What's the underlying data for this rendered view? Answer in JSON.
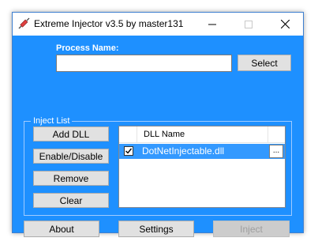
{
  "window": {
    "title": "Extreme Injector v3.5 by master131",
    "icon": "syringe-icon"
  },
  "process": {
    "label": "Process Name:",
    "value": "",
    "select_label": "Select"
  },
  "inject_list": {
    "group_title": "Inject List",
    "buttons": {
      "add": "Add DLL",
      "toggle": "Enable/Disable",
      "remove": "Remove",
      "clear": "Clear"
    },
    "columns": [
      "DLL Name"
    ],
    "items": [
      {
        "name": "DotNetInjectable.dll",
        "enabled": true,
        "browse_label": "..."
      }
    ]
  },
  "footer": {
    "about": "About",
    "settings": "Settings",
    "inject": "Inject"
  },
  "colors": {
    "background": "#1e90ff",
    "selection": "#3399ff"
  }
}
